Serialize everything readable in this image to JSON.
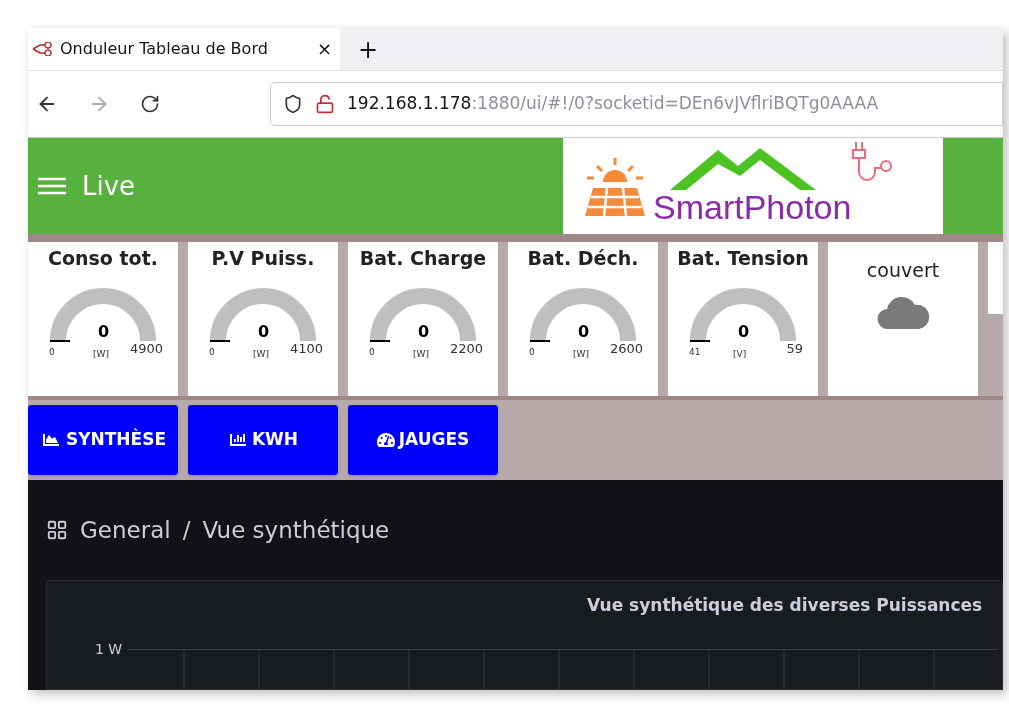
{
  "browser": {
    "tab": {
      "title": "Onduleur Tableau de Bord",
      "close": "×",
      "selected": true
    },
    "new_tab": "+",
    "url": {
      "host": "192.168.1.178",
      "rest": ":1880/ui/#!/0?socketid=DEn6vJVflriBQTg0AAAA"
    }
  },
  "header": {
    "title": "Live",
    "logo": "SmartPhoton"
  },
  "gauges": [
    {
      "title": "Conso tot.",
      "value": "0",
      "unit": "[W]",
      "min": "0",
      "max": "4900"
    },
    {
      "title": "P.V Puiss.",
      "value": "0",
      "unit": "[W]",
      "min": "0",
      "max": "4100"
    },
    {
      "title": "Bat. Charge",
      "value": "0",
      "unit": "[W]",
      "min": "0",
      "max": "2200"
    },
    {
      "title": "Bat. Déch.",
      "value": "0",
      "unit": "[W]",
      "min": "0",
      "max": "2600"
    },
    {
      "title": "Bat. Tension",
      "value": "0",
      "unit": "[V]",
      "min": "41",
      "max": "59"
    }
  ],
  "weather": {
    "label": "couvert",
    "kind": "cloud"
  },
  "nav_buttons": [
    {
      "label": "SYNTHÈSE",
      "kind": "area"
    },
    {
      "label": "KWH",
      "kind": "bar"
    },
    {
      "label": "JAUGES",
      "kind": "gauge"
    }
  ],
  "breadcrumb": [
    "General",
    "/",
    "Vue synthétique"
  ],
  "chart": {
    "title": "Vue synthétique des diverses Puissances",
    "y_tick": "1 W"
  }
}
